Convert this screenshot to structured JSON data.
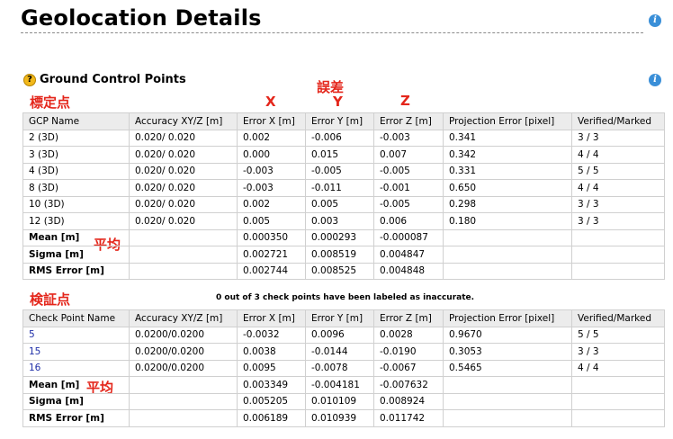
{
  "page_title": "Geolocation Details",
  "gcp_section": {
    "title": "Ground Control Points",
    "columns": [
      "GCP Name",
      "Accuracy XY/Z [m]",
      "Error X [m]",
      "Error Y [m]",
      "Error Z [m]",
      "Projection Error [pixel]",
      "Verified/Marked"
    ],
    "rows": [
      [
        "2 (3D)",
        "0.020/ 0.020",
        "0.002",
        "-0.006",
        "-0.003",
        "0.341",
        "3 / 3"
      ],
      [
        "3 (3D)",
        "0.020/ 0.020",
        "0.000",
        "0.015",
        "0.007",
        "0.342",
        "4 / 4"
      ],
      [
        "4 (3D)",
        "0.020/ 0.020",
        "-0.003",
        "-0.005",
        "-0.005",
        "0.331",
        "5 / 5"
      ],
      [
        "8 (3D)",
        "0.020/ 0.020",
        "-0.003",
        "-0.011",
        "-0.001",
        "0.650",
        "4 / 4"
      ],
      [
        "10 (3D)",
        "0.020/ 0.020",
        "0.002",
        "0.005",
        "-0.005",
        "0.298",
        "3 / 3"
      ],
      [
        "12 (3D)",
        "0.020/ 0.020",
        "0.005",
        "0.003",
        "0.006",
        "0.180",
        "3 / 3"
      ]
    ],
    "summary": [
      [
        "Mean [m]",
        "",
        "0.000350",
        "0.000293",
        "-0.000087",
        "",
        ""
      ],
      [
        "Sigma [m]",
        "",
        "0.002721",
        "0.008519",
        "0.004847",
        "",
        ""
      ],
      [
        "RMS Error [m]",
        "",
        "0.002744",
        "0.008525",
        "0.004848",
        "",
        ""
      ]
    ]
  },
  "check_note": "0 out of 3 check points have been labeled as inaccurate.",
  "check_section": {
    "columns": [
      "Check Point Name",
      "Accuracy XY/Z [m]",
      "Error X [m]",
      "Error Y [m]",
      "Error Z [m]",
      "Projection Error [pixel]",
      "Verified/Marked"
    ],
    "rows": [
      [
        "5",
        "0.0200/0.0200",
        "-0.0032",
        "0.0096",
        "0.0028",
        "0.9670",
        "5 / 5"
      ],
      [
        "15",
        "0.0200/0.0200",
        "0.0038",
        "-0.0144",
        "-0.0190",
        "0.3053",
        "3 / 3"
      ],
      [
        "16",
        "0.0200/0.0200",
        "0.0095",
        "-0.0078",
        "-0.0067",
        "0.5465",
        "4 / 4"
      ]
    ],
    "summary": [
      [
        "Mean [m]",
        "",
        "0.003349",
        "-0.004181",
        "-0.007632",
        "",
        ""
      ],
      [
        "Sigma [m]",
        "",
        "0.005205",
        "0.010109",
        "0.008924",
        "",
        ""
      ],
      [
        "RMS Error [m]",
        "",
        "0.006189",
        "0.010939",
        "0.011742",
        "",
        ""
      ]
    ]
  },
  "annotations": {
    "gcp_label": "標定点",
    "error_label": "誤差",
    "x": "X",
    "y": "Y",
    "z": "Z",
    "mean_label_1": "平均",
    "check_label": "検証点",
    "mean_label_2": "平均"
  },
  "icons": {
    "info": "info-icon",
    "help": "help-icon"
  },
  "colors": {
    "annotation_red": "#e4261b",
    "info_blue": "#3a8fd8",
    "help_yellow": "#f2b81a",
    "link_blue": "#1f2fa8",
    "header_gray": "#ececec"
  }
}
